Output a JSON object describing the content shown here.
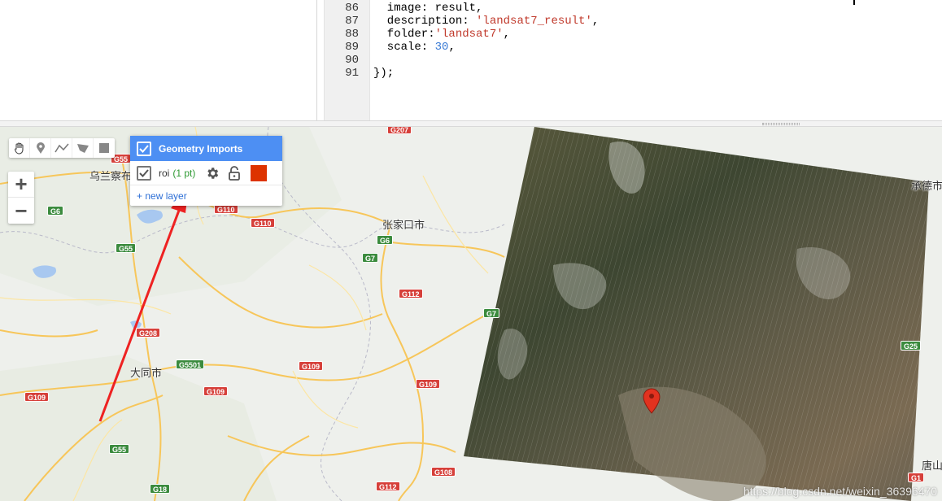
{
  "editor": {
    "lines": [
      {
        "no": "86",
        "parts": [
          {
            "t": "  image: result,",
            "c": ""
          }
        ]
      },
      {
        "no": "87",
        "parts": [
          {
            "t": "  description: ",
            "c": ""
          },
          {
            "t": "'landsat7_result'",
            "c": "str"
          },
          {
            "t": ",",
            "c": ""
          }
        ]
      },
      {
        "no": "88",
        "parts": [
          {
            "t": "  folder:",
            "c": ""
          },
          {
            "t": "'landsat7'",
            "c": "str"
          },
          {
            "t": ",",
            "c": ""
          }
        ]
      },
      {
        "no": "89",
        "parts": [
          {
            "t": "  scale: ",
            "c": ""
          },
          {
            "t": "30",
            "c": "num"
          },
          {
            "t": ",",
            "c": ""
          }
        ]
      },
      {
        "no": "90",
        "parts": [
          {
            "t": "",
            "c": ""
          }
        ]
      },
      {
        "no": "91",
        "parts": [
          {
            "t": "});",
            "c": ""
          }
        ]
      }
    ]
  },
  "map": {
    "places": [
      {
        "name": "乌兰察布",
        "key": "wulanchabu"
      },
      {
        "name": "张家口市",
        "key": "zhangjiakou"
      },
      {
        "name": "大同市",
        "key": "datong"
      },
      {
        "name": "承德市",
        "key": "chengde"
      },
      {
        "name": "唐山",
        "key": "tangshan"
      }
    ],
    "highways": [
      {
        "label": "G55",
        "color": "red",
        "key": "g55a"
      },
      {
        "label": "G207",
        "color": "red",
        "key": "g207"
      },
      {
        "label": "G6",
        "color": "green",
        "key": "g6a"
      },
      {
        "label": "G110",
        "color": "red",
        "key": "g110a"
      },
      {
        "label": "G110",
        "color": "red",
        "key": "g110b"
      },
      {
        "label": "G6",
        "color": "green",
        "key": "g6b"
      },
      {
        "label": "G55",
        "color": "green",
        "key": "g55b"
      },
      {
        "label": "G7",
        "color": "green",
        "key": "g7a"
      },
      {
        "label": "G112",
        "color": "red",
        "key": "g112a"
      },
      {
        "label": "G7",
        "color": "green",
        "key": "g7b"
      },
      {
        "label": "G208",
        "color": "red",
        "key": "g208"
      },
      {
        "label": "G5501",
        "color": "green",
        "key": "g5501"
      },
      {
        "label": "G109",
        "color": "red",
        "key": "g109a"
      },
      {
        "label": "G109",
        "color": "red",
        "key": "g109b"
      },
      {
        "label": "G109",
        "color": "red",
        "key": "g109c"
      },
      {
        "label": "G109",
        "color": "red",
        "key": "g109d"
      },
      {
        "label": "G55",
        "color": "green",
        "key": "g55c"
      },
      {
        "label": "G18",
        "color": "green",
        "key": "g18"
      },
      {
        "label": "G112",
        "color": "red",
        "key": "g112b"
      },
      {
        "label": "G108",
        "color": "red",
        "key": "g108"
      },
      {
        "label": "G25",
        "color": "green",
        "key": "g25"
      },
      {
        "label": "G1",
        "color": "red",
        "key": "g1"
      }
    ],
    "zoom_in": "+",
    "zoom_out": "−"
  },
  "toolbar": {
    "tools": [
      "hand-icon",
      "point-marker-icon",
      "line-icon",
      "polygon-icon",
      "rectangle-icon"
    ]
  },
  "geometry_panel": {
    "title": "Geometry Imports",
    "layer_name": "roi",
    "layer_count": "(1 pt)",
    "layer_color": "#dd3300",
    "new_layer": "+ new layer"
  },
  "watermark": "https://blog.csdn.net/weixin_36396470"
}
